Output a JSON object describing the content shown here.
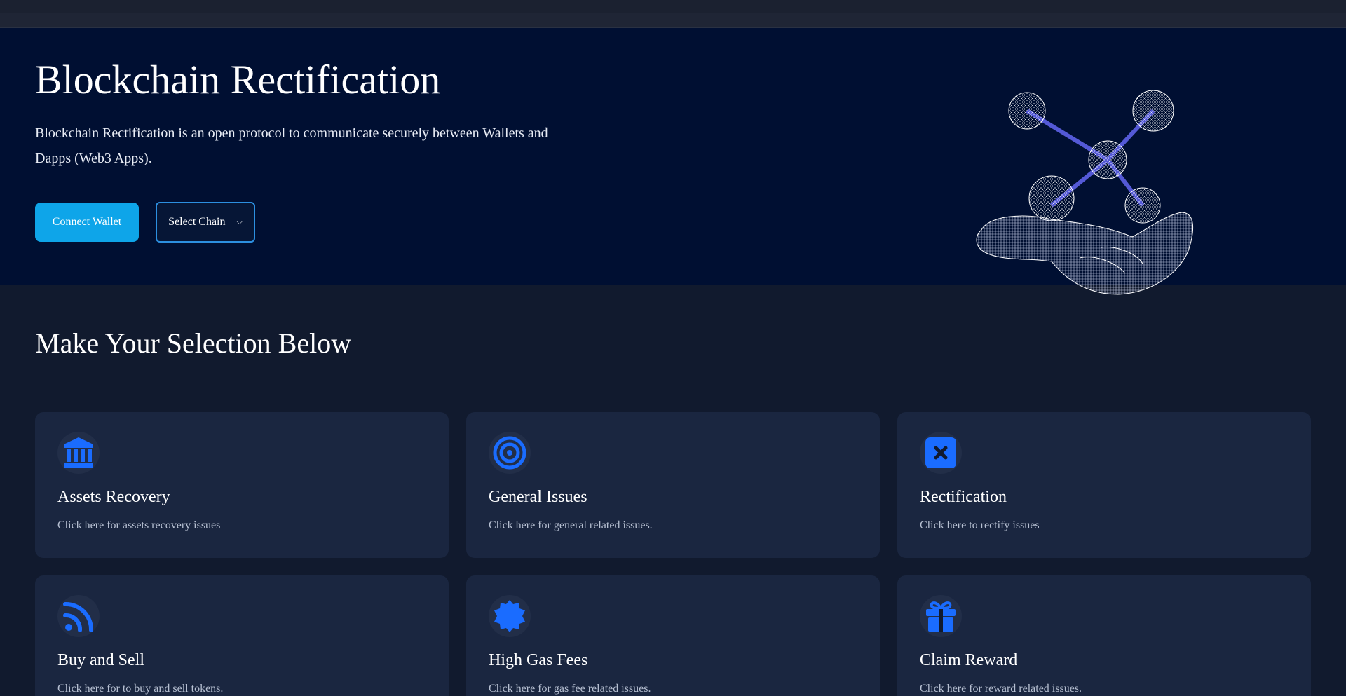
{
  "hero": {
    "title": "Blockchain Rectification",
    "description": "Blockchain Rectification is an open protocol to communicate securely between Wallets and Dapps (Web3 Apps).",
    "connect_label": "Connect Wallet",
    "chain_label": "Select Chain"
  },
  "selection": {
    "title": "Make Your Selection Below",
    "cards": [
      {
        "title": "Assets Recovery",
        "desc": "Click here for assets recovery issues",
        "icon": "bank-icon"
      },
      {
        "title": "General Issues",
        "desc": "Click here for general related issues.",
        "icon": "target-icon"
      },
      {
        "title": "Rectification",
        "desc": "Click here to rectify issues",
        "icon": "close-square-icon"
      },
      {
        "title": "Buy and Sell",
        "desc": "Click here for to buy and sell tokens.",
        "icon": "rss-icon"
      },
      {
        "title": "High Gas Fees",
        "desc": "Click here for gas fee related issues.",
        "icon": "badge-icon"
      },
      {
        "title": "Claim Reward",
        "desc": "Click here for reward related issues.",
        "icon": "gift-icon"
      }
    ]
  },
  "colors": {
    "hero_bg": "#000f32",
    "page_bg": "#111a2e",
    "card_bg": "#1a2640",
    "accent": "#0ea5e9",
    "icon_blue": "#1a6cff"
  }
}
